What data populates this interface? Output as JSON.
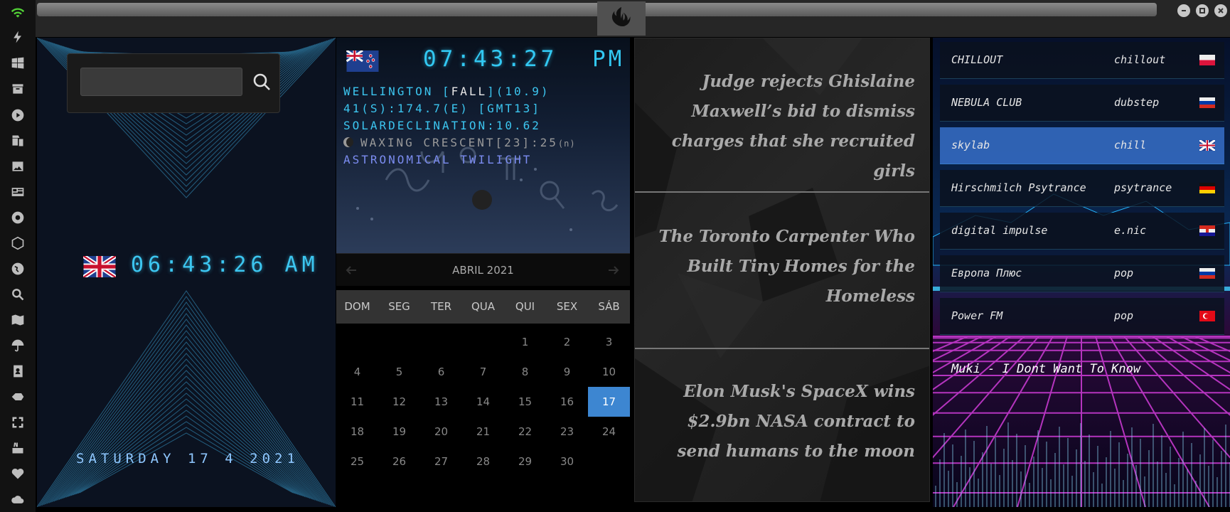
{
  "sidebar": {
    "icons": [
      "wifi-icon",
      "flash-icon",
      "windows-icon",
      "archive-icon",
      "play-icon",
      "translate-icon",
      "image-icon",
      "news-icon",
      "radio-icon",
      "hexagon-icon",
      "globe-icon",
      "search-icon",
      "map-icon",
      "umbrella-icon",
      "contacts-icon",
      "ticket-icon",
      "fullscreen-icon",
      "youtube-icon",
      "heart-icon",
      "cloud-icon"
    ]
  },
  "window": {
    "controls": [
      "minimize",
      "maximize",
      "close"
    ]
  },
  "clock": {
    "search_placeholder": "",
    "local_time": "06:43:26 AM",
    "date": "SATURDAY 17 4 2021",
    "flag": "uk"
  },
  "astro": {
    "time": "07:43:27",
    "ampm": "PM",
    "flag": "nz",
    "city_prefix": "WELLINGTON [",
    "season": "FALL",
    "city_suffix": "](10.9)",
    "coords": "41(S):174.7(E) [GMT13]",
    "declination": "SOLARDECLINATION:10.62",
    "moon": "WAXING CRESCENT[23]:25",
    "moon_suffix": "(n)",
    "twilight": "ASTRONOMICAL TWILIGHT"
  },
  "calendar": {
    "title": "ABRIL 2021",
    "weekdays": [
      "DOM",
      "SEG",
      "TER",
      "QUA",
      "QUI",
      "SEX",
      "SÁB"
    ],
    "weeks": [
      [
        "",
        "",
        "",
        "",
        "1",
        "2",
        "3"
      ],
      [
        "4",
        "5",
        "6",
        "7",
        "8",
        "9",
        "10"
      ],
      [
        "11",
        "12",
        "13",
        "14",
        "15",
        "16",
        "17"
      ],
      [
        "18",
        "19",
        "20",
        "21",
        "22",
        "23",
        "24"
      ],
      [
        "25",
        "26",
        "27",
        "28",
        "29",
        "30",
        ""
      ]
    ],
    "today": "17"
  },
  "news": [
    {
      "text": "Judge rejects Ghislaine Maxwell’s bid to dismiss charges that she recruited girls"
    },
    {
      "text": "The Toronto Carpenter Who Built Tiny Homes for the Homeless"
    },
    {
      "text": "Elon Musk's SpaceX wins $2.9bn NASA contract to send humans to the moon"
    }
  ],
  "radio": {
    "stations": [
      {
        "name": "CHILLOUT",
        "genre": "chillout",
        "flag": "pl"
      },
      {
        "name": "NEBULA CLUB",
        "genre": "dubstep",
        "flag": "ru"
      },
      {
        "name": "skylab",
        "genre": "chill",
        "flag": "uk"
      },
      {
        "name": "Hirschmilch Psytrance",
        "genre": "psytrance",
        "flag": "de"
      },
      {
        "name": "digital impulse",
        "genre": "e.nic",
        "flag": "hr"
      },
      {
        "name": "Европа Плюс",
        "genre": "pop",
        "flag": "ru"
      },
      {
        "name": "Power FM",
        "genre": "pop",
        "flag": "tr"
      }
    ],
    "active_index": 2,
    "now_playing": "Muki - I Dont Want To Know"
  },
  "colors": {
    "accent": "#3cc6f0",
    "today": "#3d86d1",
    "active_station": "#366ec8"
  }
}
